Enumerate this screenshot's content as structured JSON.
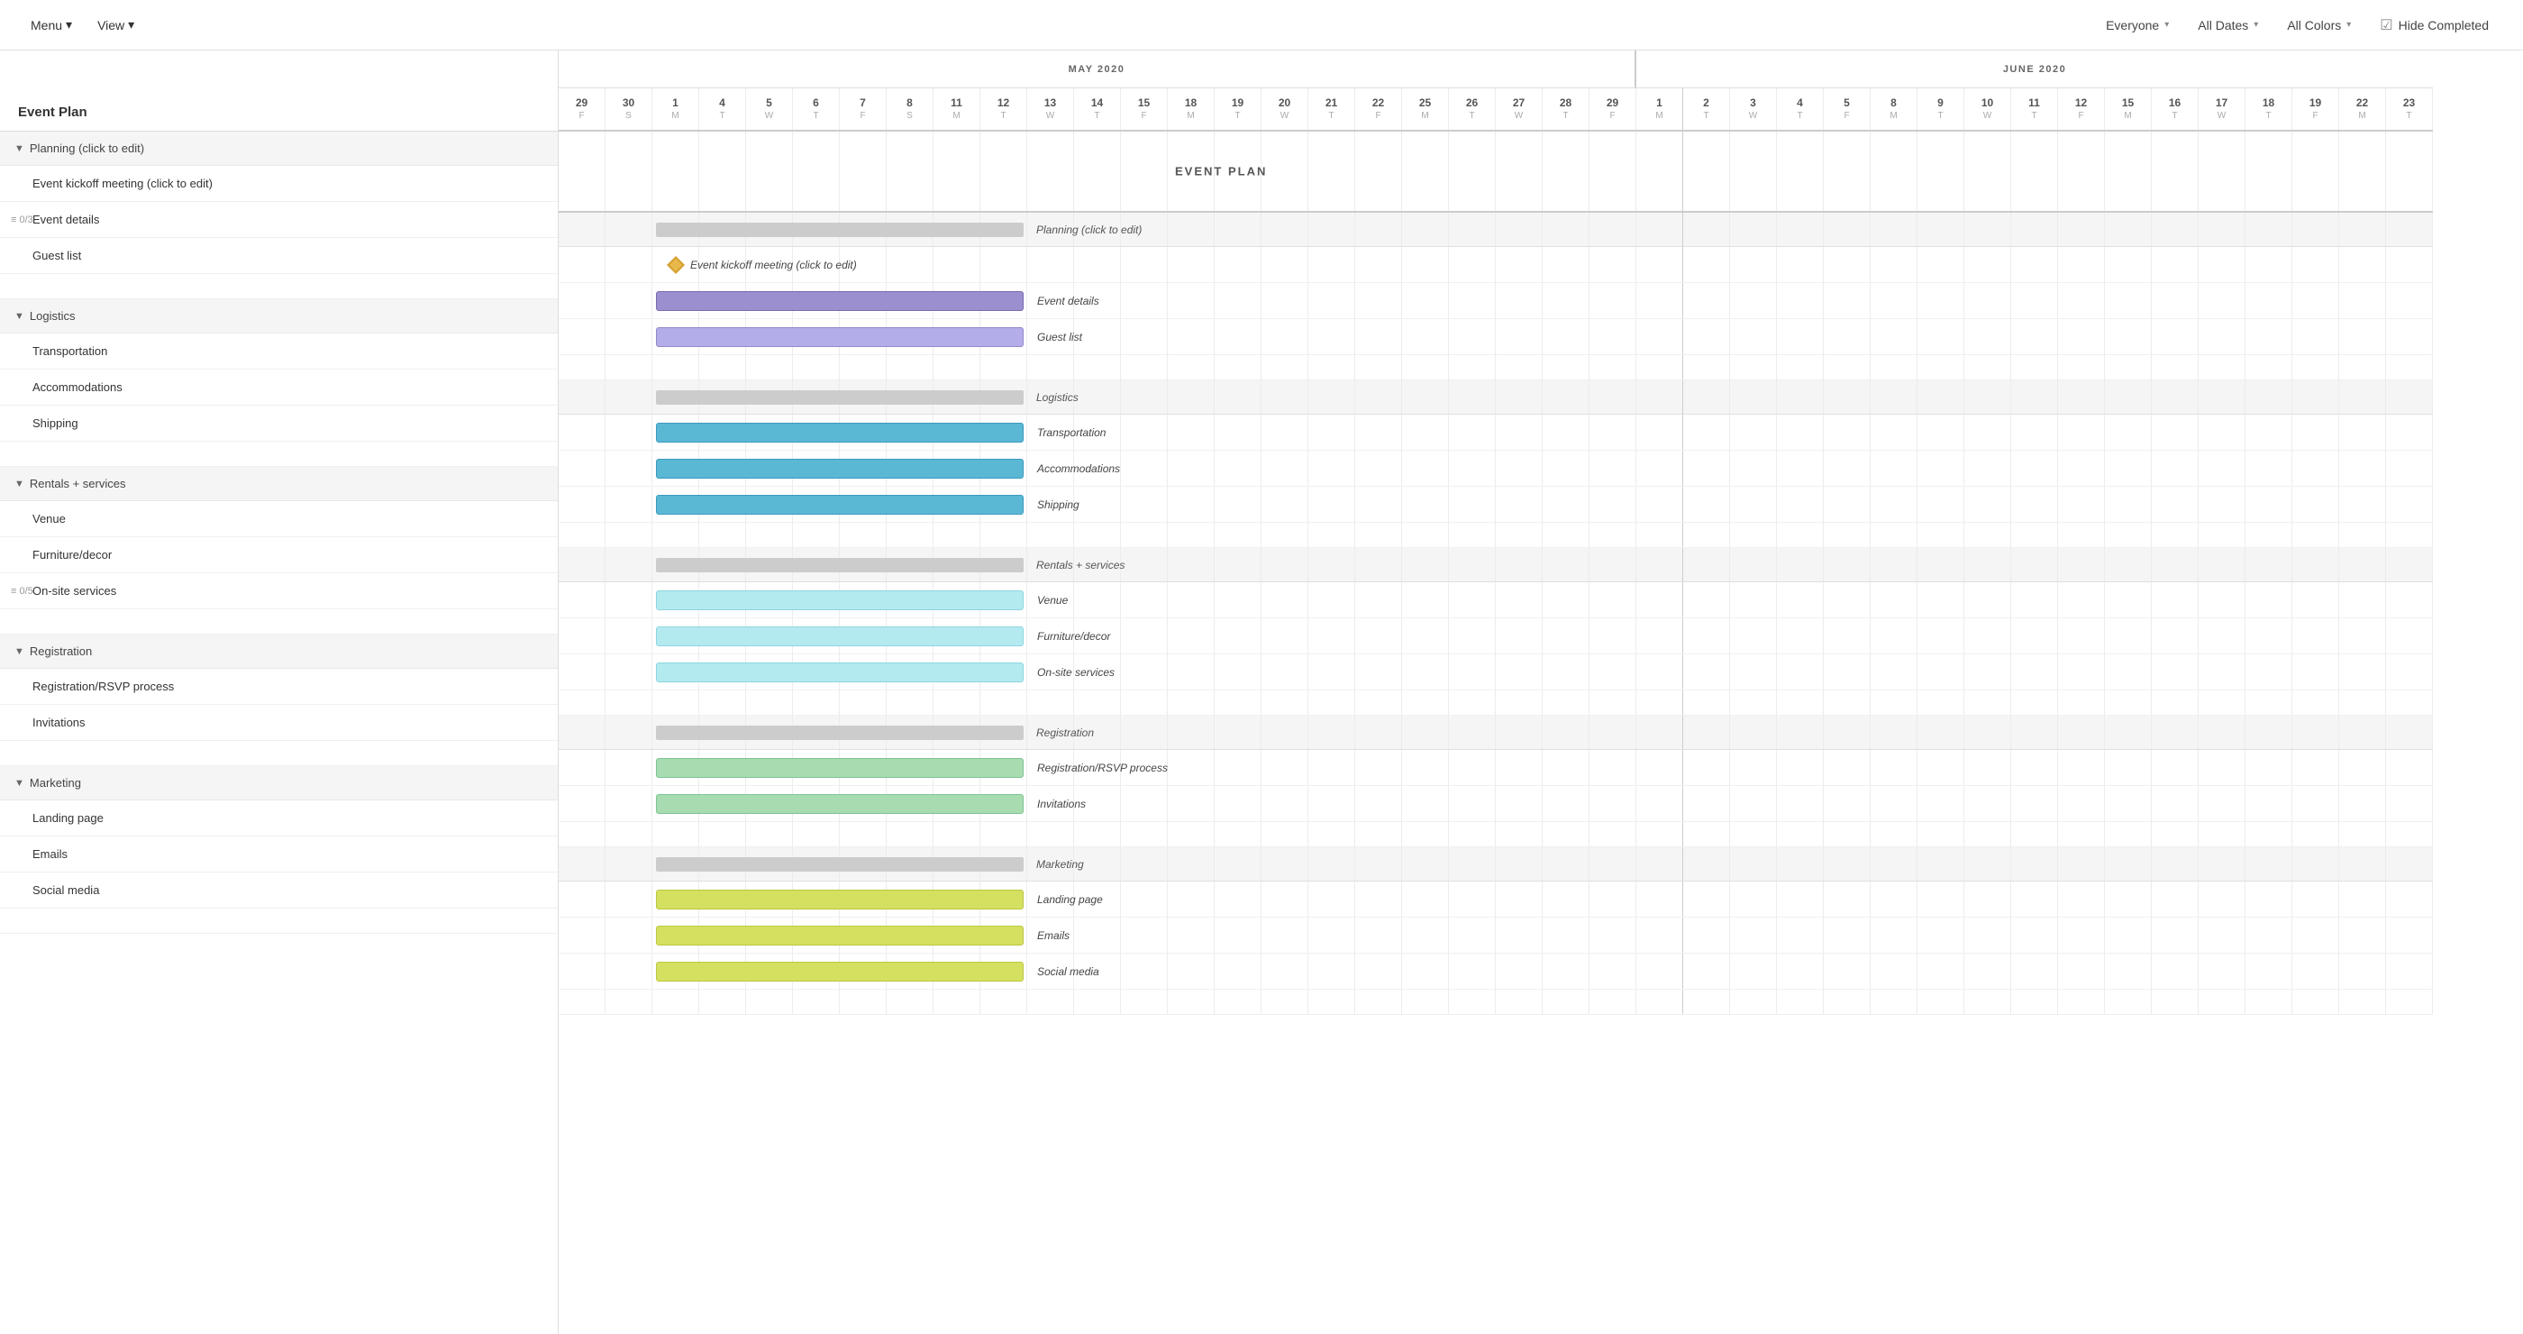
{
  "topbar": {
    "menu_label": "Menu",
    "view_label": "View",
    "everyone_label": "Everyone",
    "all_dates_label": "All Dates",
    "all_colors_label": "All Colors",
    "hide_completed_label": "Hide Completed"
  },
  "left": {
    "title": "Event Plan",
    "sections": [
      {
        "id": "planning",
        "label": "Planning (click to edit)",
        "tasks": [
          {
            "label": "Event kickoff meeting (click to edit)",
            "counter": null
          },
          {
            "label": "Event details",
            "counter": "0/3"
          },
          {
            "label": "Guest list",
            "counter": null
          }
        ]
      },
      {
        "id": "logistics",
        "label": "Logistics",
        "tasks": [
          {
            "label": "Transportation",
            "counter": null
          },
          {
            "label": "Accommodations",
            "counter": null
          },
          {
            "label": "Shipping",
            "counter": null
          }
        ]
      },
      {
        "id": "rentals",
        "label": "Rentals + services",
        "tasks": [
          {
            "label": "Venue",
            "counter": null
          },
          {
            "label": "Furniture/decor",
            "counter": null
          },
          {
            "label": "On-site services",
            "counter": "0/5"
          }
        ]
      },
      {
        "id": "registration",
        "label": "Registration",
        "tasks": [
          {
            "label": "Registration/RSVP process",
            "counter": null
          },
          {
            "label": "Invitations",
            "counter": null
          }
        ]
      },
      {
        "id": "marketing",
        "label": "Marketing",
        "tasks": [
          {
            "label": "Landing page",
            "counter": null
          },
          {
            "label": "Emails",
            "counter": null
          },
          {
            "label": "Social media",
            "counter": null
          }
        ]
      }
    ]
  },
  "gantt": {
    "event_plan_label": "EVENT PLAN",
    "months": [
      {
        "label": "MAY 2020",
        "cols": 22
      },
      {
        "label": "JUNE 2020",
        "cols": 22
      }
    ],
    "days": [
      {
        "num": "29",
        "letter": "F"
      },
      {
        "num": "30",
        "letter": "S"
      },
      {
        "num": "1",
        "letter": "M"
      },
      {
        "num": "4",
        "letter": "T"
      },
      {
        "num": "5",
        "letter": "W"
      },
      {
        "num": "6",
        "letter": "T"
      },
      {
        "num": "7",
        "letter": "F"
      },
      {
        "num": "8",
        "letter": "S"
      },
      {
        "num": "11",
        "letter": "M"
      },
      {
        "num": "12",
        "letter": "T"
      },
      {
        "num": "13",
        "letter": "W"
      },
      {
        "num": "14",
        "letter": "T"
      },
      {
        "num": "15",
        "letter": "F"
      },
      {
        "num": "18",
        "letter": "M"
      },
      {
        "num": "19",
        "letter": "T"
      },
      {
        "num": "20",
        "letter": "W"
      },
      {
        "num": "21",
        "letter": "T"
      },
      {
        "num": "22",
        "letter": "F"
      },
      {
        "num": "25",
        "letter": "M"
      },
      {
        "num": "26",
        "letter": "T"
      },
      {
        "num": "27",
        "letter": "W"
      },
      {
        "num": "28",
        "letter": "T"
      },
      {
        "num": "29",
        "letter": "F"
      },
      {
        "num": "1",
        "letter": "M"
      },
      {
        "num": "2",
        "letter": "T"
      },
      {
        "num": "3",
        "letter": "W"
      },
      {
        "num": "4",
        "letter": "T"
      },
      {
        "num": "5",
        "letter": "F"
      },
      {
        "num": "8",
        "letter": "M"
      },
      {
        "num": "9",
        "letter": "T"
      },
      {
        "num": "10",
        "letter": "W"
      },
      {
        "num": "11",
        "letter": "T"
      },
      {
        "num": "12",
        "letter": "F"
      },
      {
        "num": "15",
        "letter": "M"
      },
      {
        "num": "16",
        "letter": "T"
      },
      {
        "num": "17",
        "letter": "W"
      },
      {
        "num": "18",
        "letter": "T"
      },
      {
        "num": "19",
        "letter": "F"
      },
      {
        "num": "22",
        "letter": "M"
      },
      {
        "num": "23",
        "letter": "T"
      }
    ]
  }
}
